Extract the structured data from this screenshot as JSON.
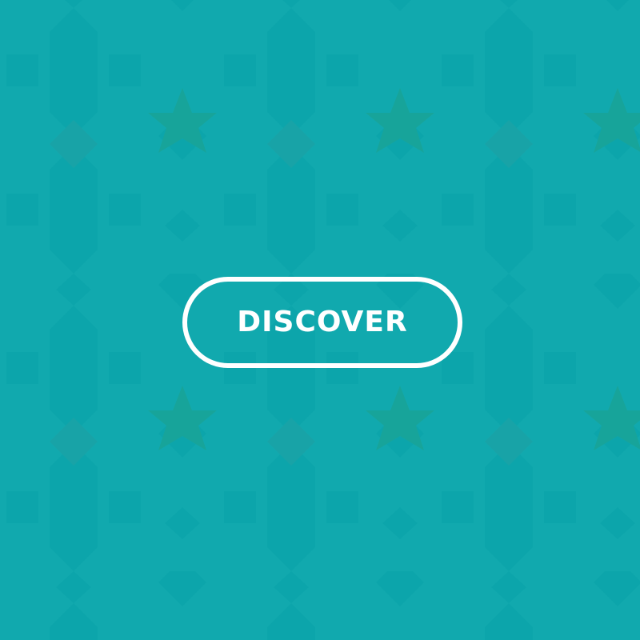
{
  "cta": {
    "label": "DISCOVER"
  },
  "background": {
    "pattern": "geometric-star-tile",
    "colors": {
      "base": "#11a9ae",
      "shade": "#0ca5ab",
      "diamond": "#18a3a7",
      "star": "#17a49a"
    }
  }
}
